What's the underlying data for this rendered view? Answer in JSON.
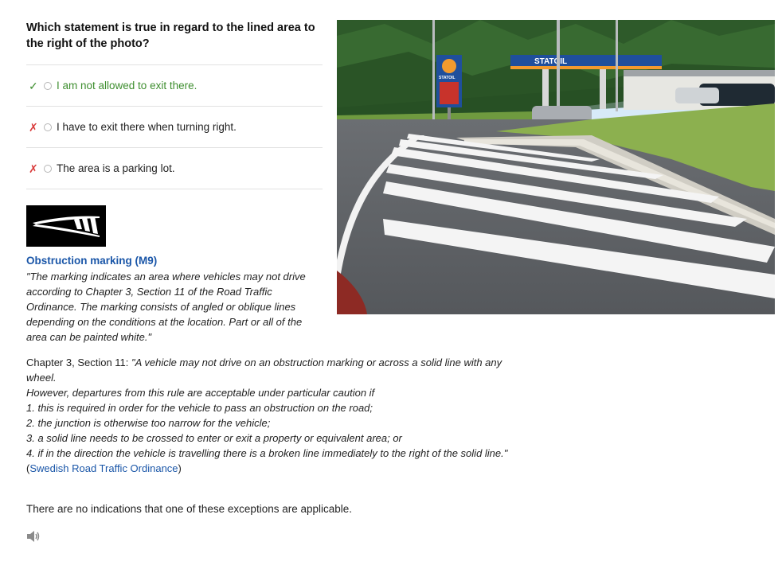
{
  "question": "Which statement is true in regard to the lined area to the right of the photo?",
  "answers": [
    {
      "mark": "✓",
      "status": "correct",
      "text": "I am not allowed to exit there."
    },
    {
      "mark": "✗",
      "status": "wrong",
      "text": "I have to exit there when turning right."
    },
    {
      "mark": "✗",
      "status": "wrong",
      "text": "The area is a parking lot."
    }
  ],
  "photo": {
    "sign_text": "STATOIL",
    "pole_sign_text": "STATOIL"
  },
  "explanation": {
    "title": "Obstruction marking (M9)",
    "quote": "\"The marking indicates an area where vehicles may not drive according to Chapter 3, Section 11 of the Road Traffic Ordinance. The marking consists of angled or oblique lines depending on the conditions at the location. Part or all of the area can be painted white.\"",
    "chapter_intro": "Chapter 3, Section 11: ",
    "chapter_quote_1": "\"A vehicle may not drive on an obstruction marking or across a solid line with any wheel.",
    "chapter_quote_2": "However, departures from this rule are acceptable under particular caution if",
    "rule_1": "1. this is required in order for the vehicle to pass an obstruction on the road;",
    "rule_2": "2. the junction is otherwise too narrow for the vehicle;",
    "rule_3": "3. a solid line needs to be crossed to enter or exit a property or equivalent area; or",
    "rule_4": "4. if in the direction the vehicle is travelling there is a broken line immediately to the right of the solid line.\"",
    "source_open": "(",
    "source_link": "Swedish Road Traffic Ordinance",
    "source_close": ")",
    "conclusion": "There are no indications that one of these exceptions are applicable."
  },
  "colors": {
    "correct": "#3e8e2f",
    "wrong": "#d93a3a",
    "link": "#1a56a8"
  },
  "icons": {
    "speaker": "speaker-icon"
  }
}
